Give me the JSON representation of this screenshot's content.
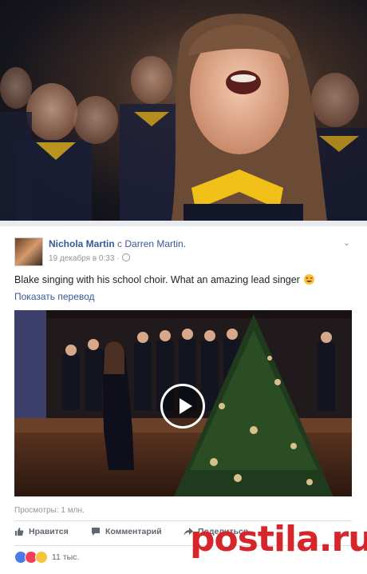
{
  "post": {
    "author": "Nichola Martin",
    "with_word": "с",
    "tagged": "Darren Martin.",
    "date": "19 декабря в 0:33 ·",
    "text": "Blake singing with his school choir. What an amazing lead singer",
    "translate_link": "Показать перевод",
    "views": "Просмотры: 1 млн.",
    "actions": {
      "like": "Нравится",
      "comment": "Комментарий",
      "share": "Поделиться"
    },
    "reactions_count": "11 тыс."
  },
  "icons": {
    "options": "chevron-down-icon",
    "privacy": "globe-icon",
    "play": "play-icon",
    "like": "thumbs-up-icon",
    "comment": "comment-icon",
    "share": "share-arrow-icon"
  },
  "watermark": {
    "text": "postila.ru"
  },
  "colors": {
    "link": "#365899",
    "accent_red": "#d6262b",
    "like_blue": "#4a79e8",
    "love_red": "#f33e58",
    "wow_yellow": "#f7c437"
  }
}
